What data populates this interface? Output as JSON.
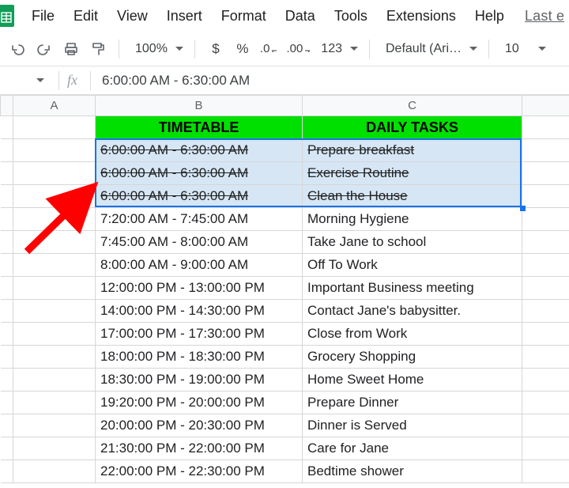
{
  "menu": {
    "items": [
      "File",
      "Edit",
      "View",
      "Insert",
      "Format",
      "Data",
      "Tools",
      "Extensions",
      "Help"
    ],
    "last_edit": "Last e"
  },
  "toolbar": {
    "zoom": "100%",
    "formats": {
      "currency": "$",
      "percent": "%",
      "dec_dec": ".0",
      "inc_dec": ".00",
      "more": "123"
    },
    "font_name": "Default (Ari…",
    "font_size": "10"
  },
  "formula_bar": {
    "fx_label": "fx",
    "content": "6:00:00 AM - 6:30:00 AM"
  },
  "columns": [
    "A",
    "B",
    "C"
  ],
  "header_row": {
    "b": "TIMETABLE",
    "c": "DAILY TASKS"
  },
  "rows": [
    {
      "b": "6:00:00 AM - 6:30:00 AM",
      "c": "Prepare breakfast",
      "strike": true,
      "selected": true
    },
    {
      "b": "6:00:00 AM - 6:30:00 AM",
      "c": "Exercise Routine",
      "strike": true,
      "selected": true
    },
    {
      "b": "6:00:00 AM - 6:30:00 AM",
      "c": "Clean the House",
      "strike": true,
      "selected": true
    },
    {
      "b": "7:20:00 AM - 7:45:00 AM",
      "c": "Morning Hygiene"
    },
    {
      "b": "7:45:00 AM - 8:00:00 AM",
      "c": "Take Jane to school"
    },
    {
      "b": "8:00:00 AM - 9:00:00 AM",
      "c": "Off To Work"
    },
    {
      "b": "12:00:00 PM - 13:00:00 PM",
      "c": "Important Business meeting"
    },
    {
      "b": "14:00:00 PM - 14:30:00 PM",
      "c": "Contact Jane's babysitter."
    },
    {
      "b": "17:00:00 PM - 17:30:00 PM",
      "c": "Close from Work"
    },
    {
      "b": "18:00:00 PM - 18:30:00 PM",
      "c": "Grocery Shopping"
    },
    {
      "b": "18:30:00 PM - 19:00:00 PM",
      "c": "Home Sweet Home"
    },
    {
      "b": "19:20:00 PM - 20:00:00 PM",
      "c": "Prepare Dinner"
    },
    {
      "b": "20:00:00 PM - 20:30:00 PM",
      "c": "Dinner is Served"
    },
    {
      "b": "21:30:00 PM - 22:00:00 PM",
      "c": "Care for Jane"
    },
    {
      "b": "22:00:00 PM - 22:30:00 PM",
      "c": "Bedtime shower"
    }
  ],
  "colors": {
    "accent": "#1a73e8",
    "header_green": "#00e000",
    "annotation_arrow": "#ff0000"
  }
}
